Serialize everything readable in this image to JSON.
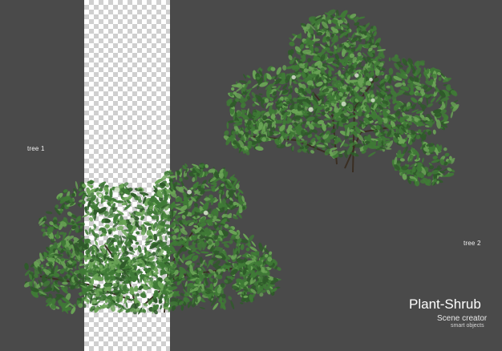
{
  "labels": {
    "tree1": "tree 1",
    "tree2": "tree 2"
  },
  "brand": {
    "title": "Plant-Shrub",
    "subtitle": "Scene creator",
    "tagline": "smart objects"
  },
  "colors": {
    "background": "#4a4a4a",
    "leaf_dark": "#2f5a2a",
    "leaf_mid": "#3f7a36",
    "leaf_light": "#6aa456",
    "trunk": "#3a2e22",
    "text": "#ffffff"
  }
}
